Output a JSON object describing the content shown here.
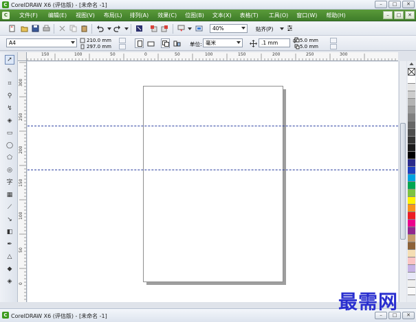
{
  "window": {
    "title": "CorelDRAW X6 (评估版) - [未命名 -1]",
    "controls": [
      "–",
      "□",
      "✕"
    ]
  },
  "menubar": {
    "items": [
      "文件(F)",
      "编辑(E)",
      "视图(V)",
      "布局(L)",
      "排列(A)",
      "效果(C)",
      "位图(B)",
      "文本(X)",
      "表格(T)",
      "工具(O)",
      "窗口(W)",
      "帮助(H)"
    ],
    "doc_controls": [
      "–",
      "□",
      "✕"
    ]
  },
  "standard_toolbar": {
    "zoom": "40%",
    "snap_label": "贴齐(P)"
  },
  "property_bar": {
    "paper": "A4",
    "width": "210.0 mm",
    "height": "297.0 mm",
    "unit_label": "单位:",
    "unit": "毫米",
    "nudge": ".1 mm",
    "dup_x": "5.0 mm",
    "dup_y": "5.0 mm"
  },
  "toolbox": {
    "tools": [
      "pick",
      "shape",
      "crop",
      "zoom",
      "freehand",
      "smart-fill",
      "rectangle",
      "ellipse",
      "polygon",
      "basic-shapes",
      "text",
      "table",
      "parallel-dimension",
      "straight-connector",
      "blend",
      "color-eyedropper",
      "outline-pen",
      "fill",
      "smart-fill-2"
    ]
  },
  "rulers": {
    "top_labels": [
      "150",
      "100",
      "50",
      "0",
      "50",
      "100",
      "150",
      "200",
      "250",
      "300"
    ],
    "left_labels": [
      "300",
      "250",
      "200",
      "150",
      "100",
      "50",
      "0"
    ]
  },
  "palette": {
    "colors": [
      "#ffffff",
      "#e6e6e6",
      "#cccccc",
      "#b3b3b3",
      "#999999",
      "#808080",
      "#666666",
      "#4d4d4d",
      "#333333",
      "#1a1a1a",
      "#000000",
      "#2a2a8a",
      "#1f3fbf",
      "#00a3e0",
      "#00a651",
      "#7dc242",
      "#fff200",
      "#f7941d",
      "#ed1c24",
      "#ec008c",
      "#92278f",
      "#c69c6d",
      "#8c6239",
      "#f5deb3",
      "#fbc4c4",
      "#c7b3e5",
      "#e8e8f8",
      "#f0f0f0",
      "#fafafa"
    ]
  },
  "taskbar": {
    "title": "CorelDRAW X6 (评估版) - [未命名 -1]"
  },
  "watermark": "最需网"
}
